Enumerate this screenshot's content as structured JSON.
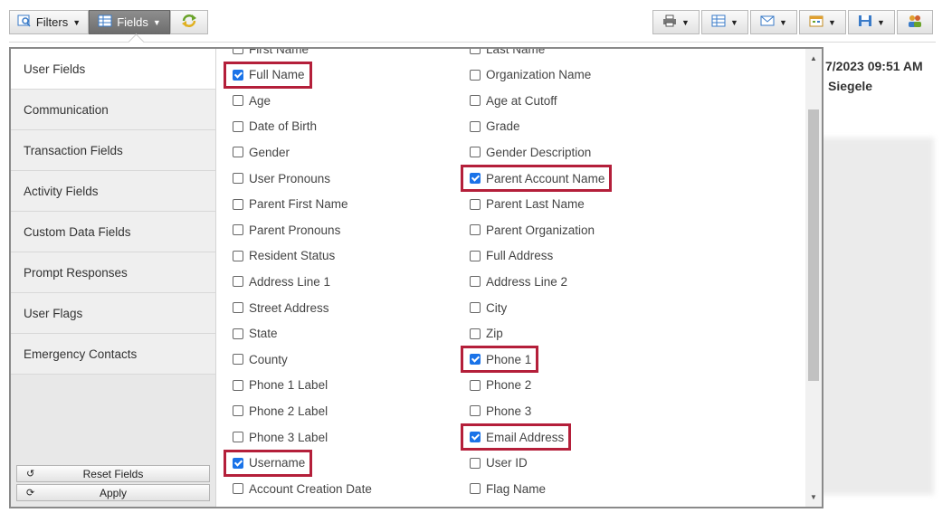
{
  "toolbar": {
    "filters_label": "Filters",
    "fields_label": "Fields"
  },
  "background": {
    "datetime": "7/2023 09:51 AM",
    "name": "Siegele"
  },
  "sidebar": {
    "items": [
      {
        "label": "User Fields",
        "selected": true
      },
      {
        "label": "Communication",
        "selected": false
      },
      {
        "label": "Transaction Fields",
        "selected": false
      },
      {
        "label": "Activity Fields",
        "selected": false
      },
      {
        "label": "Custom Data Fields",
        "selected": false
      },
      {
        "label": "Prompt Responses",
        "selected": false
      },
      {
        "label": "User Flags",
        "selected": false
      },
      {
        "label": "Emergency Contacts",
        "selected": false
      }
    ],
    "reset_label": "Reset Fields",
    "apply_label": "Apply"
  },
  "fields": {
    "left": [
      {
        "label": "First Name",
        "checked": false,
        "highlighted": false
      },
      {
        "label": "Full Name",
        "checked": true,
        "highlighted": true
      },
      {
        "label": "Age",
        "checked": false,
        "highlighted": false
      },
      {
        "label": "Date of Birth",
        "checked": false,
        "highlighted": false
      },
      {
        "label": "Gender",
        "checked": false,
        "highlighted": false
      },
      {
        "label": "User Pronouns",
        "checked": false,
        "highlighted": false
      },
      {
        "label": "Parent First Name",
        "checked": false,
        "highlighted": false
      },
      {
        "label": "Parent Pronouns",
        "checked": false,
        "highlighted": false
      },
      {
        "label": "Resident Status",
        "checked": false,
        "highlighted": false
      },
      {
        "label": "Address Line 1",
        "checked": false,
        "highlighted": false
      },
      {
        "label": "Street Address",
        "checked": false,
        "highlighted": false
      },
      {
        "label": "State",
        "checked": false,
        "highlighted": false
      },
      {
        "label": "County",
        "checked": false,
        "highlighted": false
      },
      {
        "label": "Phone 1 Label",
        "checked": false,
        "highlighted": false
      },
      {
        "label": "Phone 2 Label",
        "checked": false,
        "highlighted": false
      },
      {
        "label": "Phone 3 Label",
        "checked": false,
        "highlighted": false
      },
      {
        "label": "Username",
        "checked": true,
        "highlighted": true
      },
      {
        "label": "Account Creation Date",
        "checked": false,
        "highlighted": false
      }
    ],
    "right": [
      {
        "label": "Last Name",
        "checked": false,
        "highlighted": false
      },
      {
        "label": "Organization Name",
        "checked": false,
        "highlighted": false
      },
      {
        "label": "Age at Cutoff",
        "checked": false,
        "highlighted": false
      },
      {
        "label": "Grade",
        "checked": false,
        "highlighted": false
      },
      {
        "label": "Gender Description",
        "checked": false,
        "highlighted": false
      },
      {
        "label": "Parent Account Name",
        "checked": true,
        "highlighted": true
      },
      {
        "label": "Parent Last Name",
        "checked": false,
        "highlighted": false
      },
      {
        "label": "Parent Organization",
        "checked": false,
        "highlighted": false
      },
      {
        "label": "Full Address",
        "checked": false,
        "highlighted": false
      },
      {
        "label": "Address Line 2",
        "checked": false,
        "highlighted": false
      },
      {
        "label": "City",
        "checked": false,
        "highlighted": false
      },
      {
        "label": "Zip",
        "checked": false,
        "highlighted": false
      },
      {
        "label": "Phone 1",
        "checked": true,
        "highlighted": true
      },
      {
        "label": "Phone 2",
        "checked": false,
        "highlighted": false
      },
      {
        "label": "Phone 3",
        "checked": false,
        "highlighted": false
      },
      {
        "label": "Email Address",
        "checked": true,
        "highlighted": true
      },
      {
        "label": "User ID",
        "checked": false,
        "highlighted": false
      },
      {
        "label": "Flag Name",
        "checked": false,
        "highlighted": false
      }
    ]
  },
  "colors": {
    "highlight": "#b41f3a",
    "checkbox_checked": "#1a73e8",
    "active_button": "#7a7a7a"
  },
  "icons": [
    "filter-icon",
    "fields-grid-icon",
    "refresh-icon",
    "print-icon",
    "table-icon",
    "email-icon",
    "calendar-icon",
    "save-icon",
    "users-icon",
    "undo-icon",
    "apply-icon"
  ]
}
